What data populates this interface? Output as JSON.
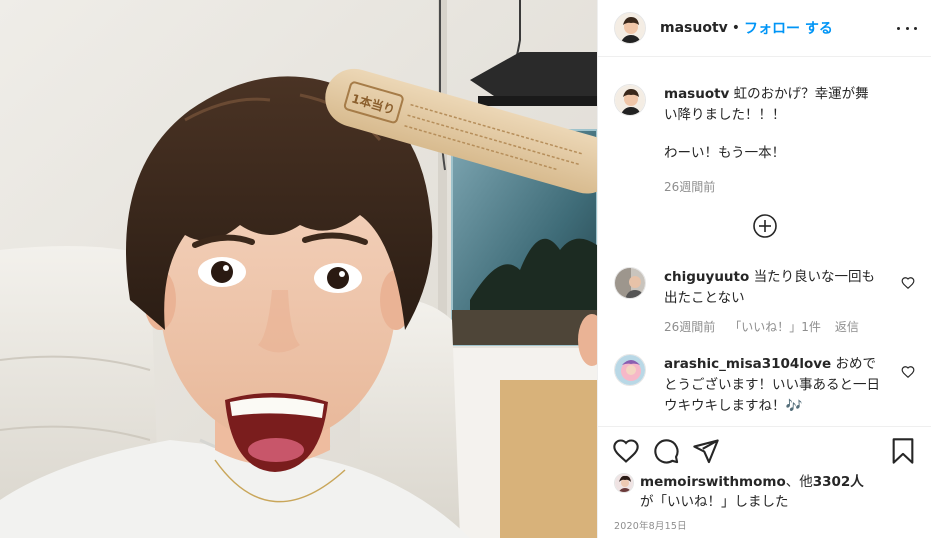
{
  "post": {
    "username": "masuotv",
    "separator": "•",
    "follow_label": "フォロー する",
    "caption_line1": "虹のおかげ？幸運が舞い降りました！！！",
    "caption_line2": "わーい！もう一本！",
    "caption_time": "26週間前",
    "date": "2020年8月15日"
  },
  "popsicle_stick": {
    "stamp": "1本当り"
  },
  "comments": [
    {
      "username": "chiguyuuto",
      "text": "当たり良いな一回も出たことない",
      "time": "26週間前",
      "likes": "「いいね！」1件",
      "reply": "返信"
    },
    {
      "username": "arashic_misa3104love",
      "text": "おめでとうございます！いい事あると一日ウキウキしますね！🎶"
    }
  ],
  "likes_summary": {
    "user": "memoirswithmomo",
    "suffix_prefix": "、他",
    "count": "3302人",
    "line2": "が「いいね！」しました"
  },
  "icons": {
    "more": "more-options-icon",
    "load_more": "plus-circle-icon",
    "like": "heart-icon",
    "comment": "comment-icon",
    "share": "share-icon",
    "save": "bookmark-icon"
  },
  "colors": {
    "accent": "#0095f6",
    "text": "#262626",
    "muted": "#8e8e8e",
    "border": "#efefef"
  }
}
